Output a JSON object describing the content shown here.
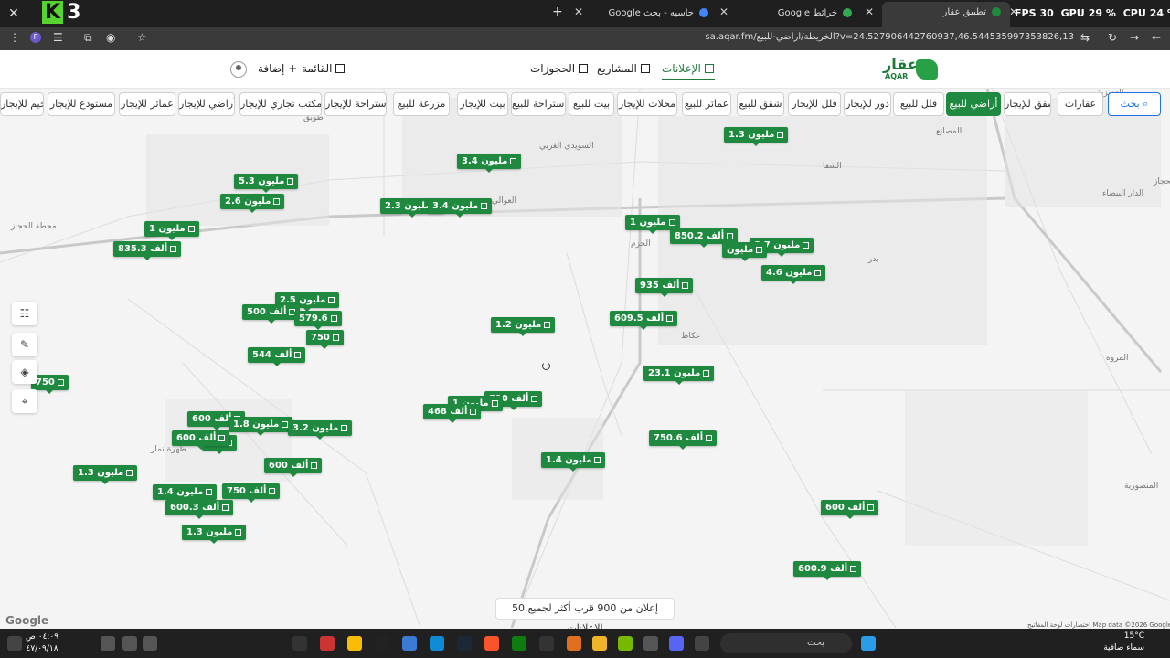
{
  "browser": {
    "perf": {
      "fps_label": "FPS",
      "fps": "30",
      "gpu_label": "GPU",
      "gpu": "29 %",
      "cpu_label": "CPU",
      "cpu": "24 %"
    },
    "tabs": [
      {
        "title": "تطبيق عقار",
        "color": "#1f8a3f"
      },
      {
        "title": "خرائط Google",
        "color": "#34a853"
      },
      {
        "title": "حاسبه - بحث Google",
        "color": "#4285f4"
      }
    ],
    "url": "sa.aqar.fm/الخريطة/أراضي-للبيع?v=24.527906442760937,46.544535997353826,13"
  },
  "header": {
    "logo_ar": "عقار",
    "logo_en": "AQAR",
    "nav": {
      "listings": "الإعلانات",
      "projects": "المشاريع",
      "bookings": "الحجوزات",
      "list": "القائمة",
      "add": "إضافة"
    }
  },
  "chips": {
    "search": "بحث",
    "items": [
      "عقارات",
      "شقق للإيجار",
      "أراضي للبيع",
      "فلل للبيع",
      "دور للإيجار",
      "فلل للإيجار",
      "شقق للبيع",
      "عمائر للبيع",
      "محلات للإيجار",
      "بيت للبيع",
      "استراحة للبيع",
      "بيت للإيجار",
      "مزرعة للبيع",
      "استراحة للإيجار",
      "مكتب تجاري للإيجار",
      "أراضي للإيجار",
      "عمائر للإيجار",
      "مستودع للإيجار",
      "مخيم للإيجار"
    ],
    "active": "أراضي للبيع"
  },
  "map": {
    "places": {
      "p1": "الحجاز",
      "p2": "طويق",
      "p3": "العوالي",
      "p4": "الشفا",
      "p5": "المصانع",
      "p6": "الدار البيضاء",
      "p7": "بدر",
      "p8": "محطة الحجاز",
      "p9": "العزيزية",
      "p10": "ظهرة نمار",
      "p11": "المروة",
      "p12": "عكاظ",
      "p13": "الحزم",
      "p14": "المنصورية",
      "p15": "السويدي الغربي"
    },
    "pins": [
      {
        "label": "1.3 مليون"
      },
      {
        "label": "3.4 مليون"
      },
      {
        "label": "5.3 مليون"
      },
      {
        "label": "2.6 مليون"
      },
      {
        "label": "2.3 مليون"
      },
      {
        "label": "3.4 مليون"
      },
      {
        "label": "1 مليون"
      },
      {
        "label": "835.3 ألف"
      },
      {
        "label": "1 مليون"
      },
      {
        "label": "850.2 ألف"
      },
      {
        "label": "8.7 مليون"
      },
      {
        "label": "مليون"
      },
      {
        "label": "4.6 مليون"
      },
      {
        "label": "935 ألف"
      },
      {
        "label": "2.5 مليون"
      },
      {
        "label": "500 ألف"
      },
      {
        "label": "579.6"
      },
      {
        "label": "1.2 مليون"
      },
      {
        "label": "609.5 ألف"
      },
      {
        "label": "750"
      },
      {
        "label": "544 ألف"
      },
      {
        "label": "23.1 مليون"
      },
      {
        "label": "750"
      },
      {
        "label": "510 ألف"
      },
      {
        "label": "1 مليون"
      },
      {
        "label": "468 ألف"
      },
      {
        "label": "600 ألف"
      },
      {
        "label": "1.8 مليون"
      },
      {
        "label": "3.2 مليون"
      },
      {
        "label": "1.7"
      },
      {
        "label": "600 ألف"
      },
      {
        "label": "750.6 ألف"
      },
      {
        "label": "1.4 مليون"
      },
      {
        "label": "600 ألف"
      },
      {
        "label": "1.3 مليون"
      },
      {
        "label": "1.4 مليون"
      },
      {
        "label": "750 ألف"
      },
      {
        "label": "600.3 ألف"
      },
      {
        "label": "600 ألف"
      },
      {
        "label": "1.3 مليون"
      },
      {
        "label": "600.9 ألف"
      }
    ],
    "results_text": "50 إعلان من 900 قرب أكثر لجميع الإعلانات",
    "google": "Google",
    "attribution": "اختصارات لوحة المفاتيح   Map data ©2026 Google   البنود"
  },
  "taskbar": {
    "search": "بحث",
    "weather_temp": "15°C",
    "weather_desc": "سماء صافية",
    "time": "٠٤:٠٩ ص",
    "date": "٤٧/٠٩/١٨"
  }
}
